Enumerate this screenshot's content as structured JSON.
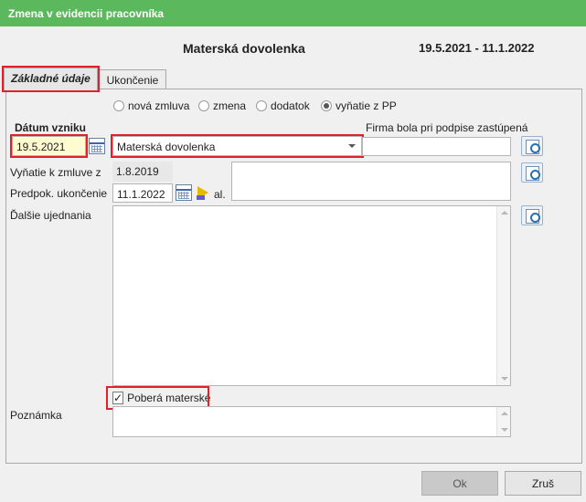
{
  "window": {
    "title": "Zmena v evidencii pracovníka"
  },
  "header": {
    "title": "Materská dovolenka",
    "dates": "19.5.2021 - 11.1.2022"
  },
  "tabs": [
    {
      "label": "Základné údaje",
      "active": true
    },
    {
      "label": "Ukončenie",
      "active": false
    }
  ],
  "contract_types": [
    {
      "label": "nová zmluva",
      "selected": false
    },
    {
      "label": "zmena",
      "selected": false
    },
    {
      "label": "dodatok",
      "selected": false
    },
    {
      "label": "vyňatie z PP",
      "selected": true
    }
  ],
  "form": {
    "date_label": "Dátum vzniku",
    "date_value": "19.5.2021",
    "type_value": "Materská dovolenka",
    "firm_label": "Firma bola pri podpise zastúpená",
    "firm_value": "",
    "exemption_label": "Vyňatie k zmluve z",
    "exemption_value": "1.8.2019",
    "expected_end_label": "Predpok. ukončenie",
    "expected_end_value": "11.1.2022",
    "al_label": "al.",
    "other_label": "Ďalšie ujednania",
    "maternity_label": "Poberá materské",
    "maternity_checked": "✓",
    "note_label": "Poznámka"
  },
  "buttons": {
    "ok": "Ok",
    "cancel": "Zruš"
  },
  "colors": {
    "titlebar": "#5cb85c",
    "highlight": "#e0202a",
    "date_field": "#fffbd0"
  }
}
